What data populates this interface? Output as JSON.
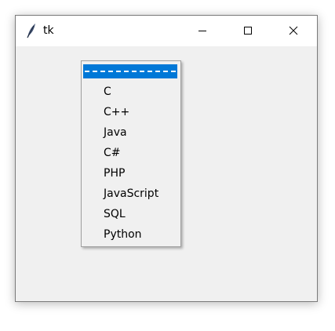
{
  "window": {
    "title": "tk",
    "controls": {
      "minimize": "minimize-icon",
      "maximize": "maximize-icon",
      "close": "close-icon"
    },
    "app_icon": "tk-feather-icon"
  },
  "menu": {
    "tearoff": "tearoff-separator",
    "items": [
      {
        "label": "C"
      },
      {
        "label": "C++"
      },
      {
        "label": "Java"
      },
      {
        "label": "C#"
      },
      {
        "label": "PHP"
      },
      {
        "label": "JavaScript"
      },
      {
        "label": "SQL"
      },
      {
        "label": "Python"
      }
    ]
  },
  "colors": {
    "selection": "#0078d7",
    "window_bg": "#f0f0f0",
    "titlebar_bg": "#ffffff"
  }
}
